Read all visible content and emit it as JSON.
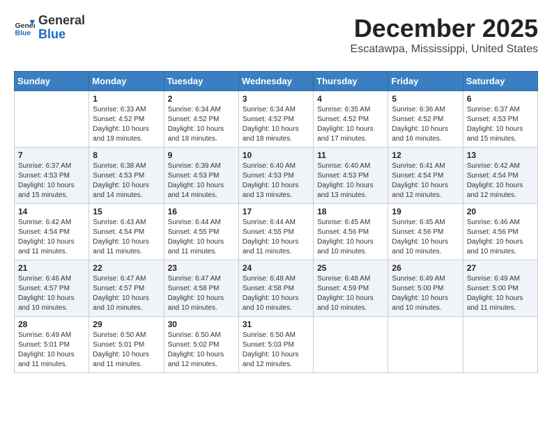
{
  "header": {
    "logo_general": "General",
    "logo_blue": "Blue",
    "month": "December 2025",
    "location": "Escatawpa, Mississippi, United States"
  },
  "days_of_week": [
    "Sunday",
    "Monday",
    "Tuesday",
    "Wednesday",
    "Thursday",
    "Friday",
    "Saturday"
  ],
  "weeks": [
    [
      {
        "day": "",
        "info": ""
      },
      {
        "day": "1",
        "info": "Sunrise: 6:33 AM\nSunset: 4:52 PM\nDaylight: 10 hours\nand 19 minutes."
      },
      {
        "day": "2",
        "info": "Sunrise: 6:34 AM\nSunset: 4:52 PM\nDaylight: 10 hours\nand 18 minutes."
      },
      {
        "day": "3",
        "info": "Sunrise: 6:34 AM\nSunset: 4:52 PM\nDaylight: 10 hours\nand 18 minutes."
      },
      {
        "day": "4",
        "info": "Sunrise: 6:35 AM\nSunset: 4:52 PM\nDaylight: 10 hours\nand 17 minutes."
      },
      {
        "day": "5",
        "info": "Sunrise: 6:36 AM\nSunset: 4:52 PM\nDaylight: 10 hours\nand 16 minutes."
      },
      {
        "day": "6",
        "info": "Sunrise: 6:37 AM\nSunset: 4:53 PM\nDaylight: 10 hours\nand 15 minutes."
      }
    ],
    [
      {
        "day": "7",
        "info": "Sunrise: 6:37 AM\nSunset: 4:53 PM\nDaylight: 10 hours\nand 15 minutes."
      },
      {
        "day": "8",
        "info": "Sunrise: 6:38 AM\nSunset: 4:53 PM\nDaylight: 10 hours\nand 14 minutes."
      },
      {
        "day": "9",
        "info": "Sunrise: 6:39 AM\nSunset: 4:53 PM\nDaylight: 10 hours\nand 14 minutes."
      },
      {
        "day": "10",
        "info": "Sunrise: 6:40 AM\nSunset: 4:53 PM\nDaylight: 10 hours\nand 13 minutes."
      },
      {
        "day": "11",
        "info": "Sunrise: 6:40 AM\nSunset: 4:53 PM\nDaylight: 10 hours\nand 13 minutes."
      },
      {
        "day": "12",
        "info": "Sunrise: 6:41 AM\nSunset: 4:54 PM\nDaylight: 10 hours\nand 12 minutes."
      },
      {
        "day": "13",
        "info": "Sunrise: 6:42 AM\nSunset: 4:54 PM\nDaylight: 10 hours\nand 12 minutes."
      }
    ],
    [
      {
        "day": "14",
        "info": "Sunrise: 6:42 AM\nSunset: 4:54 PM\nDaylight: 10 hours\nand 11 minutes."
      },
      {
        "day": "15",
        "info": "Sunrise: 6:43 AM\nSunset: 4:54 PM\nDaylight: 10 hours\nand 11 minutes."
      },
      {
        "day": "16",
        "info": "Sunrise: 6:44 AM\nSunset: 4:55 PM\nDaylight: 10 hours\nand 11 minutes."
      },
      {
        "day": "17",
        "info": "Sunrise: 6:44 AM\nSunset: 4:55 PM\nDaylight: 10 hours\nand 11 minutes."
      },
      {
        "day": "18",
        "info": "Sunrise: 6:45 AM\nSunset: 4:56 PM\nDaylight: 10 hours\nand 10 minutes."
      },
      {
        "day": "19",
        "info": "Sunrise: 6:45 AM\nSunset: 4:56 PM\nDaylight: 10 hours\nand 10 minutes."
      },
      {
        "day": "20",
        "info": "Sunrise: 6:46 AM\nSunset: 4:56 PM\nDaylight: 10 hours\nand 10 minutes."
      }
    ],
    [
      {
        "day": "21",
        "info": "Sunrise: 6:46 AM\nSunset: 4:57 PM\nDaylight: 10 hours\nand 10 minutes."
      },
      {
        "day": "22",
        "info": "Sunrise: 6:47 AM\nSunset: 4:57 PM\nDaylight: 10 hours\nand 10 minutes."
      },
      {
        "day": "23",
        "info": "Sunrise: 6:47 AM\nSunset: 4:58 PM\nDaylight: 10 hours\nand 10 minutes."
      },
      {
        "day": "24",
        "info": "Sunrise: 6:48 AM\nSunset: 4:58 PM\nDaylight: 10 hours\nand 10 minutes."
      },
      {
        "day": "25",
        "info": "Sunrise: 6:48 AM\nSunset: 4:59 PM\nDaylight: 10 hours\nand 10 minutes."
      },
      {
        "day": "26",
        "info": "Sunrise: 6:49 AM\nSunset: 5:00 PM\nDaylight: 10 hours\nand 10 minutes."
      },
      {
        "day": "27",
        "info": "Sunrise: 6:49 AM\nSunset: 5:00 PM\nDaylight: 10 hours\nand 11 minutes."
      }
    ],
    [
      {
        "day": "28",
        "info": "Sunrise: 6:49 AM\nSunset: 5:01 PM\nDaylight: 10 hours\nand 11 minutes."
      },
      {
        "day": "29",
        "info": "Sunrise: 6:50 AM\nSunset: 5:01 PM\nDaylight: 10 hours\nand 11 minutes."
      },
      {
        "day": "30",
        "info": "Sunrise: 6:50 AM\nSunset: 5:02 PM\nDaylight: 10 hours\nand 12 minutes."
      },
      {
        "day": "31",
        "info": "Sunrise: 6:50 AM\nSunset: 5:03 PM\nDaylight: 10 hours\nand 12 minutes."
      },
      {
        "day": "",
        "info": ""
      },
      {
        "day": "",
        "info": ""
      },
      {
        "day": "",
        "info": ""
      }
    ]
  ]
}
